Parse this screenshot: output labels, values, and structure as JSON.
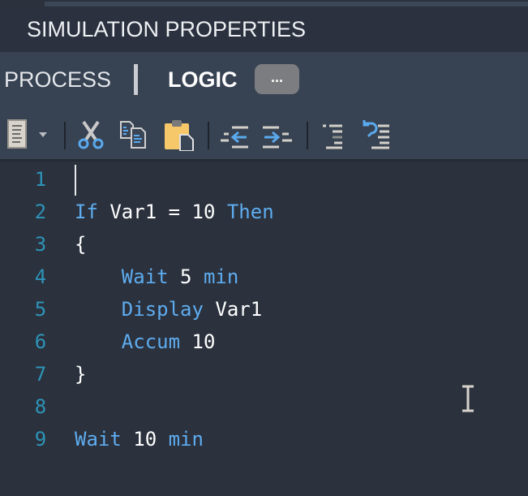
{
  "window": {
    "title": "SIMULATION PROPERTIES"
  },
  "tabs": [
    {
      "label": "PROCESS",
      "active": false
    },
    {
      "label": "LOGIC",
      "active": true
    }
  ],
  "more_button": {
    "label": "..."
  },
  "toolbar": {
    "buttons": [
      {
        "name": "document-format",
        "icon": "document-icon"
      },
      {
        "name": "format-dropdown",
        "icon": "chevron-down-icon"
      },
      {
        "name": "cut",
        "icon": "scissors-icon"
      },
      {
        "name": "copy",
        "icon": "copy-icon"
      },
      {
        "name": "paste",
        "icon": "clipboard-icon"
      },
      {
        "name": "outdent",
        "icon": "outdent-icon"
      },
      {
        "name": "indent",
        "icon": "indent-icon"
      },
      {
        "name": "format-code",
        "icon": "align-right-icon"
      },
      {
        "name": "undo-format",
        "icon": "undo-format-icon"
      }
    ]
  },
  "colors": {
    "keyword": "#5eacef",
    "plain": "#ffffff",
    "line_number": "#2d94b8",
    "background": "#2b313d",
    "toolbar": "#374252"
  },
  "editor": {
    "cursor_line": 1,
    "lines": [
      {
        "no": "1",
        "tokens": []
      },
      {
        "no": "2",
        "tokens": [
          {
            "t": "If",
            "k": "kw"
          },
          {
            "t": " Var1 = 10 ",
            "k": "plain"
          },
          {
            "t": "Then",
            "k": "kw"
          }
        ]
      },
      {
        "no": "3",
        "tokens": [
          {
            "t": "{",
            "k": "plain"
          }
        ]
      },
      {
        "no": "4",
        "tokens": [
          {
            "t": "    ",
            "k": "plain"
          },
          {
            "t": "Wait",
            "k": "kw"
          },
          {
            "t": " 5 ",
            "k": "plain"
          },
          {
            "t": "min",
            "k": "kw"
          }
        ]
      },
      {
        "no": "5",
        "tokens": [
          {
            "t": "    ",
            "k": "plain"
          },
          {
            "t": "Display",
            "k": "kw"
          },
          {
            "t": " Var1",
            "k": "plain"
          }
        ]
      },
      {
        "no": "6",
        "tokens": [
          {
            "t": "    ",
            "k": "plain"
          },
          {
            "t": "Accum",
            "k": "kw"
          },
          {
            "t": " 10",
            "k": "plain"
          }
        ]
      },
      {
        "no": "7",
        "tokens": [
          {
            "t": "}",
            "k": "plain"
          }
        ]
      },
      {
        "no": "8",
        "tokens": []
      },
      {
        "no": "9",
        "tokens": [
          {
            "t": "Wait",
            "k": "kw"
          },
          {
            "t": " 10 ",
            "k": "plain"
          },
          {
            "t": "min",
            "k": "kw"
          }
        ]
      }
    ]
  }
}
